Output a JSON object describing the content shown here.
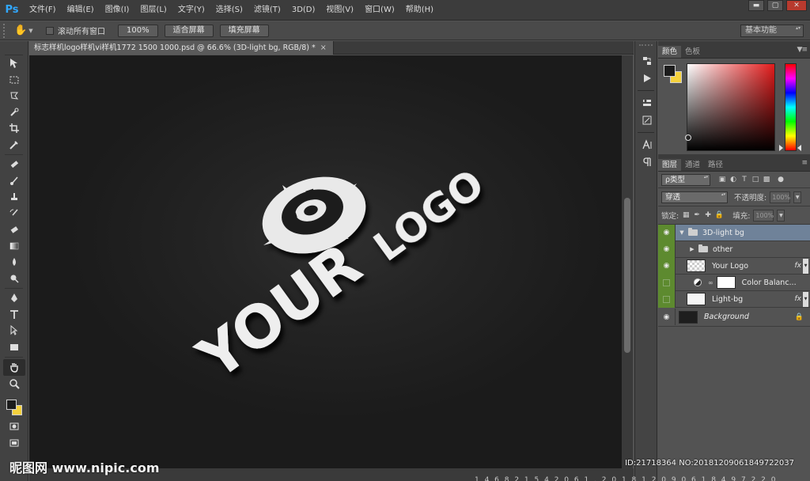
{
  "app": {
    "logo": "Ps"
  },
  "menu": [
    "文件(F)",
    "编辑(E)",
    "图像(I)",
    "图层(L)",
    "文字(Y)",
    "选择(S)",
    "滤镜(T)",
    "3D(D)",
    "视图(V)",
    "窗口(W)",
    "帮助(H)"
  ],
  "window_controls": {
    "minimize": "▬",
    "restore": "▢",
    "close": "✕"
  },
  "options": {
    "scroll_all_label": "滚动所有窗口",
    "zoom_btn": "100%",
    "fit_btn": "适合屏幕",
    "fill_btn": "填充屏幕",
    "workspace": "基本功能"
  },
  "document": {
    "tab_title": "标志样机logo样机vi样机1772 1500 1000.psd @ 66.6% (3D-light bg, RGB/8) *",
    "tab_close": "×"
  },
  "artwork": {
    "word1": "YOUR",
    "word2": "LOGO"
  },
  "watermark": {
    "site": "昵图网 www.nipic.com",
    "id": "ID:21718364 NO:20181209061849722037",
    "stripe": "1 4 6 8 2 1 5 4 2 0 6 1 . 2 0 1 8 1 2 0 9 0 6 1 8 4 9 7 2 2 0 3 7"
  },
  "panels": {
    "color_tabs": [
      "颜色",
      "色板"
    ],
    "layer_tabs": [
      "图层",
      "通道",
      "路径"
    ],
    "filter_kind": "ρ类型",
    "blend_mode": "穿透",
    "opacity_label": "不透明度:",
    "opacity_value": "100%",
    "lock_label": "锁定:",
    "fill_label": "填充:",
    "fill_value": "100%"
  },
  "layers": [
    {
      "name": "3D-light bg",
      "type": "group-open"
    },
    {
      "name": "other",
      "type": "group-closed"
    },
    {
      "name": "Your Logo",
      "type": "smart",
      "fx": "fx"
    },
    {
      "name": "Color Balanc...",
      "type": "adjustment"
    },
    {
      "name": "Light-bg",
      "type": "white",
      "fx": "fx"
    },
    {
      "name": "Background",
      "type": "background"
    }
  ],
  "colors": {
    "accent_blue": "#31a8ff",
    "bg_swatch": "#f4d13d",
    "layer_selected": "#6f8299",
    "eye_green": "#5d8a2f"
  }
}
